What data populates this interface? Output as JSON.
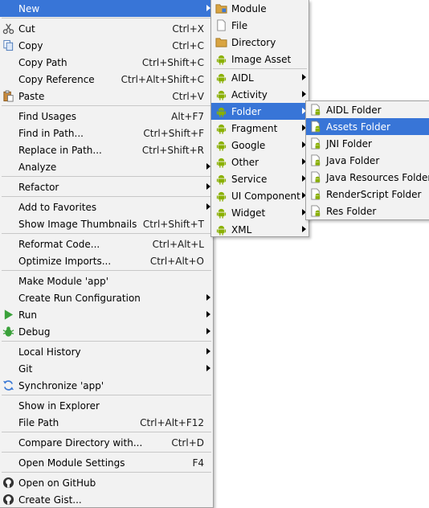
{
  "main_menu": {
    "new": "New",
    "cut": {
      "label": "Cut",
      "shortcut": "Ctrl+X"
    },
    "copy": {
      "label": "Copy",
      "shortcut": "Ctrl+C"
    },
    "copy_path": {
      "label": "Copy Path",
      "shortcut": "Ctrl+Shift+C"
    },
    "copy_reference": {
      "label": "Copy Reference",
      "shortcut": "Ctrl+Alt+Shift+C"
    },
    "paste": {
      "label": "Paste",
      "shortcut": "Ctrl+V"
    },
    "find_usages": {
      "label": "Find Usages",
      "shortcut": "Alt+F7"
    },
    "find_in_path": {
      "label": "Find in Path...",
      "shortcut": "Ctrl+Shift+F"
    },
    "replace_in_path": {
      "label": "Replace in Path...",
      "shortcut": "Ctrl+Shift+R"
    },
    "analyze": "Analyze",
    "refactor": "Refactor",
    "add_to_favorites": "Add to Favorites",
    "show_thumbnails": {
      "label": "Show Image Thumbnails",
      "shortcut": "Ctrl+Shift+T"
    },
    "reformat_code": {
      "label": "Reformat Code...",
      "shortcut": "Ctrl+Alt+L"
    },
    "optimize_imports": {
      "label": "Optimize Imports...",
      "shortcut": "Ctrl+Alt+O"
    },
    "make_module": "Make Module 'app'",
    "create_run_config": "Create Run Configuration",
    "run": "Run",
    "debug": "Debug",
    "local_history": "Local History",
    "git": "Git",
    "synchronize": "Synchronize 'app'",
    "show_in_explorer": "Show in Explorer",
    "file_path": {
      "label": "File Path",
      "shortcut": "Ctrl+Alt+F12"
    },
    "compare_directory": {
      "label": "Compare Directory with...",
      "shortcut": "Ctrl+D"
    },
    "open_module_settings": {
      "label": "Open Module Settings",
      "shortcut": "F4"
    },
    "open_on_github": "Open on GitHub",
    "create_gist": "Create Gist..."
  },
  "new_submenu": [
    "Module",
    "File",
    "Directory",
    "Image Asset",
    "AIDL",
    "Activity",
    "Folder",
    "Fragment",
    "Google",
    "Other",
    "Service",
    "UI Component",
    "Widget",
    "XML"
  ],
  "folder_submenu": [
    "AIDL Folder",
    "Assets Folder",
    "JNI Folder",
    "Java Folder",
    "Java Resources Folder",
    "RenderScript Folder",
    "Res Folder"
  ],
  "colors": {
    "highlight": "#3875d7",
    "android_green": "#8ab000",
    "menu_bg": "#f2f2f2"
  }
}
